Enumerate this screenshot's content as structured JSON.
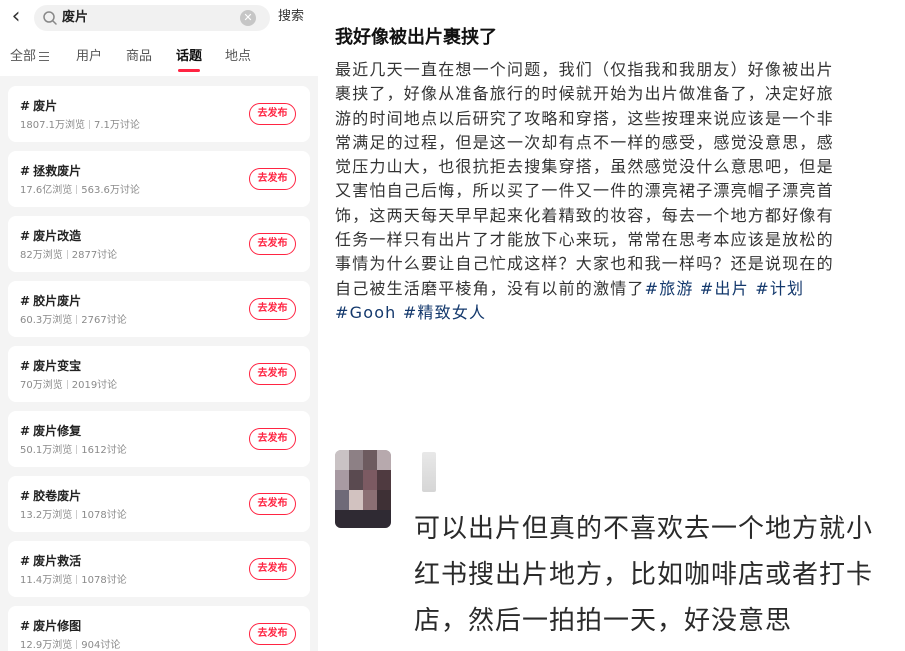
{
  "search": {
    "back_icon": "chevron-left-icon",
    "query": "废片",
    "button_label": "搜索"
  },
  "tabs": [
    {
      "label": "全部",
      "active": false
    },
    {
      "label": "用户",
      "active": false
    },
    {
      "label": "商品",
      "active": false
    },
    {
      "label": "话题",
      "active": true
    },
    {
      "label": "地点",
      "active": false
    }
  ],
  "topics": [
    {
      "name": "废片",
      "views": "1807.1万浏览",
      "discussions": "7.1万讨论",
      "button": "去发布"
    },
    {
      "name": "拯救废片",
      "views": "17.6亿浏览",
      "discussions": "563.6万讨论",
      "button": "去发布"
    },
    {
      "name": "废片改造",
      "views": "82万浏览",
      "discussions": "2877讨论",
      "button": "去发布"
    },
    {
      "name": "胶片废片",
      "views": "60.3万浏览",
      "discussions": "2767讨论",
      "button": "去发布"
    },
    {
      "name": "废片变宝",
      "views": "70万浏览",
      "discussions": "2019讨论",
      "button": "去发布"
    },
    {
      "name": "废片修复",
      "views": "50.1万浏览",
      "discussions": "1612讨论",
      "button": "去发布"
    },
    {
      "name": "胶卷废片",
      "views": "13.2万浏览",
      "discussions": "1078讨论",
      "button": "去发布"
    },
    {
      "name": "废片救活",
      "views": "11.4万浏览",
      "discussions": "1078讨论",
      "button": "去发布"
    },
    {
      "name": "废片修图",
      "views": "12.9万浏览",
      "discussions": "904讨论",
      "button": "去发布"
    }
  ],
  "post": {
    "title": "我好像被出片裹挟了",
    "body": "最近几天一直在想一个问题，我们（仅指我和我朋友）好像被出片裹挟了，好像从准备旅行的时候就开始为出片做准备了，决定好旅游的时间地点以后研究了攻略和穿搭，这些按理来说应该是一个非常满足的过程，但是这一次却有点不一样的感受，感觉没意思，感觉压力山大，也很抗拒去搜集穿搭，虽然感觉没什么意思吧，但是又害怕自己后悔，所以买了一件又一件的漂亮裙子漂亮帽子漂亮首饰，这两天每天早早起来化着精致的妆容，每去一个地方都好像有任务一样只有出片了才能放下心来玩，常常在思考本应该是放松的事情为什么要让自己忙成这样？大家也和我一样吗？还是说现在的自己被生活磨平棱角，没有以前的激情了",
    "hashtags": [
      "#旅游",
      "#出片",
      "#计划",
      "#Gooh",
      "#精致女人"
    ],
    "colors": {
      "hashtag": "#13386c",
      "accent": "#ff2442"
    }
  },
  "comment": {
    "avatar_icon": "blurred-avatar",
    "text": "可以出片但真的不喜欢去一个地方就小红书搜出片地方，比如咖啡店或者打卡店，然后一拍拍一天，好没意思"
  }
}
